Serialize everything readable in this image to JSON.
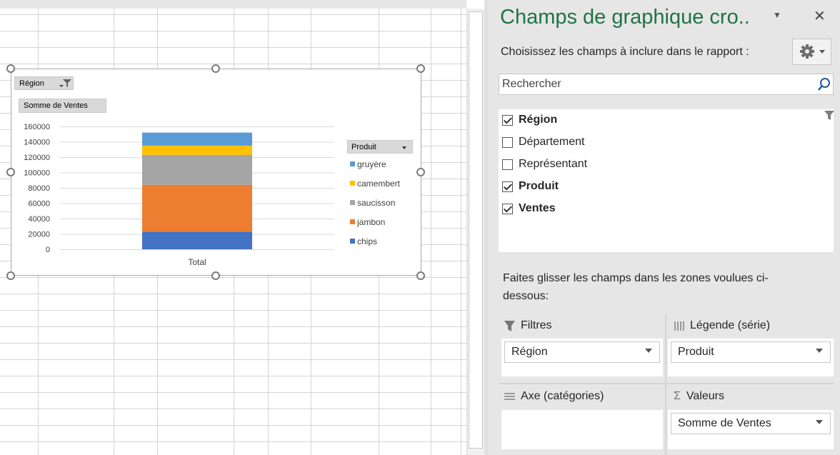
{
  "chart": {
    "filter_button": "Région",
    "value_button": "Somme de Ventes",
    "legend_title": "Produit"
  },
  "chart_data": {
    "type": "bar",
    "stacked": true,
    "categories": [
      "Total"
    ],
    "series": [
      {
        "name": "chips",
        "values": [
          23000
        ],
        "color": "#4472c4"
      },
      {
        "name": "jambon",
        "values": [
          61000
        ],
        "color": "#ed7d31"
      },
      {
        "name": "saucisson",
        "values": [
          39000
        ],
        "color": "#a5a5a5"
      },
      {
        "name": "camembert",
        "values": [
          12000
        ],
        "color": "#ffc000"
      },
      {
        "name": "gruyère",
        "values": [
          17000
        ],
        "color": "#5b9bd5"
      }
    ],
    "yticks": [
      "0",
      "20000",
      "40000",
      "60000",
      "80000",
      "100000",
      "120000",
      "140000",
      "160000"
    ],
    "ylim": [
      0,
      160000
    ],
    "legend_position": "right",
    "grid": true
  },
  "pane": {
    "title": "Champs de graphique cro..",
    "choose_label": "Choisissez les champs à inclure dans le rapport :",
    "search_placeholder": "Rechercher",
    "fields": [
      {
        "label": "Région",
        "checked": true
      },
      {
        "label": "Département",
        "checked": false
      },
      {
        "label": "Représentant",
        "checked": false
      },
      {
        "label": "Produit",
        "checked": true
      },
      {
        "label": "Ventes",
        "checked": true
      }
    ],
    "drag_hint": "Faites glisser les champs dans les zones voulues ci-dessous:",
    "zones": {
      "filters": {
        "label": "Filtres",
        "item": "Région"
      },
      "legend": {
        "label": "Légende (série)",
        "item": "Produit"
      },
      "axis": {
        "label": "Axe (catégories)"
      },
      "values": {
        "label": "Valeurs",
        "item": "Somme de Ventes"
      }
    },
    "accent_color": "#217346"
  }
}
